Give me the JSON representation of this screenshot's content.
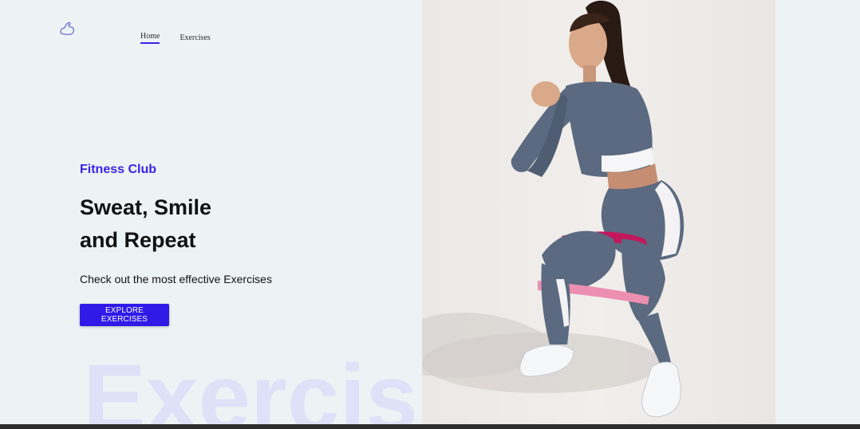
{
  "nav": {
    "logo_icon": "bicep-icon",
    "items": [
      {
        "label": "Home",
        "active": true
      },
      {
        "label": "Exercises",
        "active": false
      }
    ]
  },
  "hero": {
    "tagline": "Fitness Club",
    "headline_line1": "Sweat, Smile",
    "headline_line2": "and Repeat",
    "subtitle": "Check out the most effective Exercises",
    "cta_label": "EXPLORE EXERCISES"
  },
  "watermark": "Exercis",
  "colors": {
    "accent": "#3a23e6",
    "button": "#2f1ae8",
    "background": "#edf3f5",
    "watermark": "#dfe1f8"
  }
}
